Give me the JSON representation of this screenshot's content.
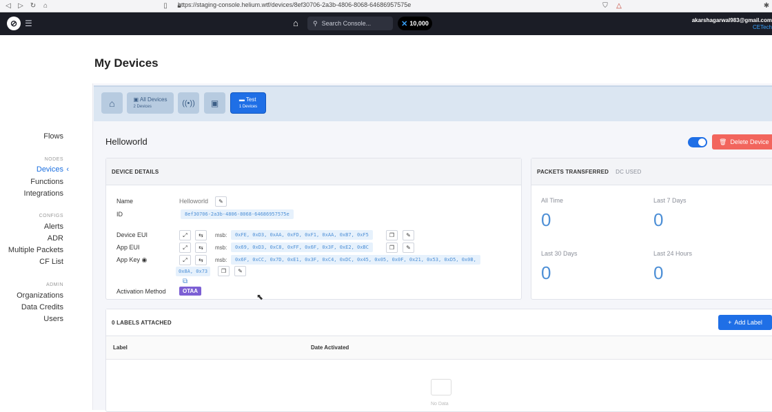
{
  "browser": {
    "url": "https://staging-console.helium.wtf/devices/8ef30706-2a3b-4806-8068-64686957575e"
  },
  "topnav": {
    "search_placeholder": "Search Console...",
    "dc_balance": "10,000",
    "user_email": "akarshagarwal983@gmail.com",
    "org": "CETech"
  },
  "sidebar": {
    "flows": "Flows",
    "nodes_head": "NODES",
    "devices": "Devices",
    "functions": "Functions",
    "integrations": "Integrations",
    "configs_head": "CONFIGS",
    "alerts": "Alerts",
    "adr": "ADR",
    "multiple_packets": "Multiple Packets",
    "cf_list": "CF List",
    "admin_head": "ADMIN",
    "organizations": "Organizations",
    "data_credits": "Data Credits",
    "users": "Users"
  },
  "page": {
    "title": "My Devices"
  },
  "crumbs": {
    "all_devices": "All Devices",
    "all_devices_count": "2 Devices",
    "test": "Test",
    "test_count": "1 Devices"
  },
  "device": {
    "title": "Helloworld",
    "delete_label": "Delete Device",
    "details_head": "DEVICE DETAILS",
    "name_label": "Name",
    "name_value": "Helloworld",
    "id_label": "ID",
    "id_value": "8ef30706-2a3b-4806-8068-64686957575e",
    "dev_eui_label": "Device EUI",
    "dev_eui_value": "0xFE, 0xD3, 0xAA, 0xFD, 0xF1, 0xAA, 0xB7, 0xF5",
    "app_eui_label": "App EUI",
    "app_eui_value": "0x69, 0xD3, 0xC8, 0xFF, 0x6F, 0x3F, 0xE2, 0xBC",
    "app_key_label": "App Key",
    "app_key_value_1": "0x6F, 0xCC, 0x7D, 0xE1, 0x3F, 0xC4, 0xDC, 0x45, 0x05, 0x0F, 0x21, 0x53, 0xD5, 0x0B,",
    "app_key_value_2": "0x8A, 0x73",
    "msb": "msb:",
    "activation_label": "Activation Method",
    "activation_value": "OTAA"
  },
  "packets": {
    "head": "PACKETS TRANSFERRED",
    "tab2": "DC USED",
    "all_time_label": "All Time",
    "all_time_value": "0",
    "last7_label": "Last 7 Days",
    "last7_value": "0",
    "last30_label": "Last 30 Days",
    "last30_value": "0",
    "last24_label": "Last 24 Hours",
    "last24_value": "0"
  },
  "labels": {
    "head": "0 LABELS ATTACHED",
    "add_label": "Add Label",
    "col_label": "Label",
    "col_date": "Date Activated",
    "no_data": "No Data"
  }
}
